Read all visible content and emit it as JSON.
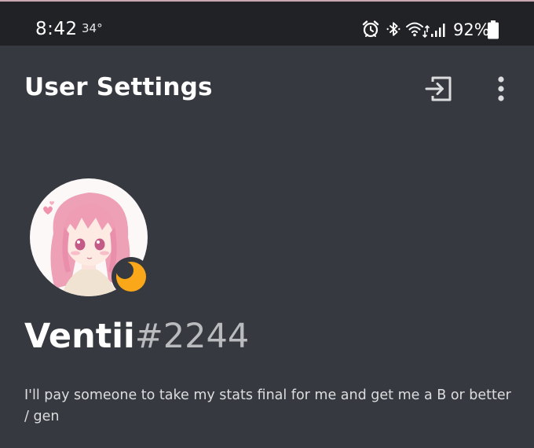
{
  "status_bar": {
    "time": "8:42",
    "temperature": "34°",
    "icons": [
      "alarm-icon",
      "bluetooth-icon",
      "wifi-icon",
      "signal-icon"
    ],
    "battery": "92%"
  },
  "app_bar": {
    "title": "User Settings",
    "actions": [
      "logout-icon",
      "more-vertical-icon"
    ]
  },
  "profile": {
    "username": "Ventii",
    "discriminator": "#2244",
    "status": "idle",
    "status_color": "#faa81a",
    "bio": "I'll pay someone to take my stats final for me and get me a B or better / gen"
  },
  "colors": {
    "background": "#36393f",
    "status_bar": "#202225",
    "discriminator": "#b9bbbe"
  }
}
